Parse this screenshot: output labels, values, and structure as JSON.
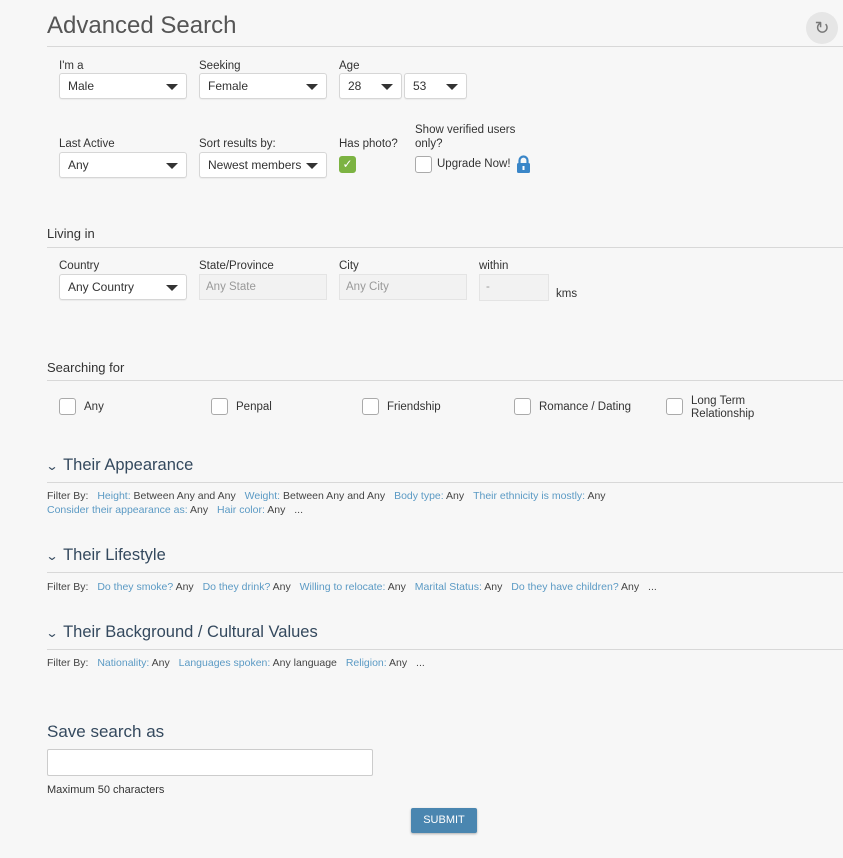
{
  "title": "Advanced Search",
  "basic": {
    "im_a": {
      "label": "I'm a",
      "value": "Male"
    },
    "seeking": {
      "label": "Seeking",
      "value": "Female"
    },
    "age": {
      "label": "Age",
      "min": "28",
      "max": "53"
    },
    "last_active": {
      "label": "Last Active",
      "value": "Any"
    },
    "sort": {
      "label": "Sort results by:",
      "value": "Newest members"
    },
    "has_photo": {
      "label": "Has photo?",
      "checked": true
    },
    "verified": {
      "label": "Show verified users only?",
      "upgrade": "Upgrade Now!",
      "checked": false
    }
  },
  "living": {
    "heading": "Living in",
    "country": {
      "label": "Country",
      "value": "Any Country"
    },
    "state": {
      "label": "State/Province",
      "placeholder": "Any State"
    },
    "city": {
      "label": "City",
      "placeholder": "Any City"
    },
    "within": {
      "label": "within",
      "placeholder": "-",
      "unit": "kms"
    }
  },
  "searching": {
    "heading": "Searching for",
    "options": [
      "Any",
      "Penpal",
      "Friendship",
      "Romance / Dating",
      "Long Term Relationship"
    ]
  },
  "sections": [
    {
      "title": "Their Appearance",
      "filter_by": "Filter By:",
      "filters": [
        {
          "k": "Height:",
          "v": "Between Any and Any"
        },
        {
          "k": "Weight:",
          "v": "Between Any and Any"
        },
        {
          "k": "Body type:",
          "v": "Any"
        },
        {
          "k": "Their ethnicity is mostly:",
          "v": "Any"
        },
        {
          "k": "Consider their appearance as:",
          "v": "Any"
        },
        {
          "k": "Hair color:",
          "v": "Any"
        }
      ],
      "more": "..."
    },
    {
      "title": "Their Lifestyle",
      "filter_by": "Filter By:",
      "filters": [
        {
          "k": "Do they smoke?",
          "v": "Any"
        },
        {
          "k": "Do they drink?",
          "v": "Any"
        },
        {
          "k": "Willing to relocate:",
          "v": "Any"
        },
        {
          "k": "Marital Status:",
          "v": "Any"
        },
        {
          "k": "Do they have children?",
          "v": "Any"
        }
      ],
      "more": "..."
    },
    {
      "title": "Their Background / Cultural Values",
      "filter_by": "Filter By:",
      "filters": [
        {
          "k": "Nationality:",
          "v": "Any"
        },
        {
          "k": "Languages spoken:",
          "v": "Any language"
        },
        {
          "k": "Religion:",
          "v": "Any"
        }
      ],
      "more": "..."
    }
  ],
  "save": {
    "heading": "Save search as",
    "value": "",
    "hint": "Maximum 50 characters",
    "submit": "SUBMIT"
  },
  "colors": {
    "accent": "#4a86b0",
    "link": "#5b9ac4",
    "check": "#7cb342",
    "heading": "#34495e"
  }
}
